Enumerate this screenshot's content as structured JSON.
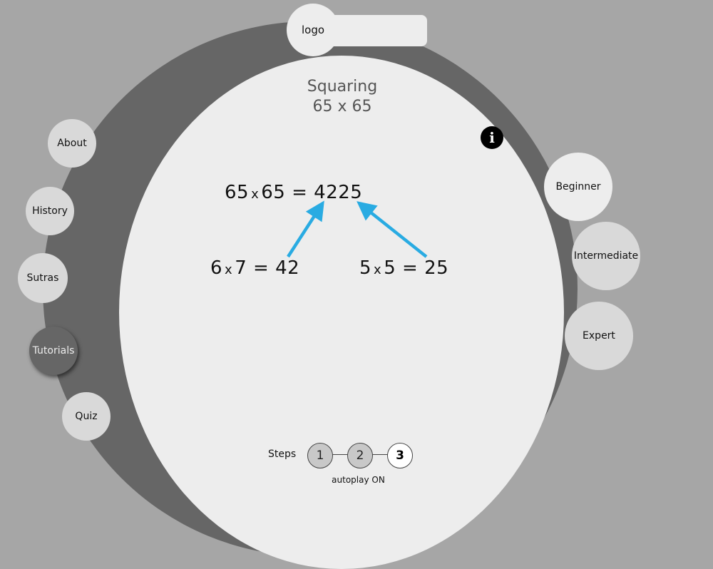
{
  "logo": {
    "label": "logo"
  },
  "header": {
    "title": "Squaring",
    "problem": "65 x 65"
  },
  "info": {
    "icon": "info-icon",
    "glyph": "i"
  },
  "nav": {
    "items": [
      {
        "label": "About"
      },
      {
        "label": "History"
      },
      {
        "label": "Sutras"
      },
      {
        "label": "Tutorials",
        "active": true
      },
      {
        "label": "Quiz"
      }
    ]
  },
  "levels": {
    "items": [
      {
        "label": "Beginner"
      },
      {
        "label": "Intermediate"
      },
      {
        "label": "Expert"
      }
    ]
  },
  "equations": {
    "main": {
      "a": "65",
      "op": "x",
      "b": "65",
      "eq": "=",
      "result": "4225"
    },
    "left": {
      "a": "6",
      "op": "x",
      "b": "7",
      "eq": "=",
      "result": "42"
    },
    "right": {
      "a": "5",
      "op": "x",
      "b": "5",
      "eq": "=",
      "result": "25"
    }
  },
  "colors": {
    "background": "#a6a6a6",
    "ring": "#666666",
    "disc": "#ededed",
    "arrow": "#29abe2"
  },
  "steps": {
    "label": "Steps",
    "items": [
      "1",
      "2",
      "3"
    ],
    "current": "3",
    "autoplay": "autoplay ON"
  }
}
